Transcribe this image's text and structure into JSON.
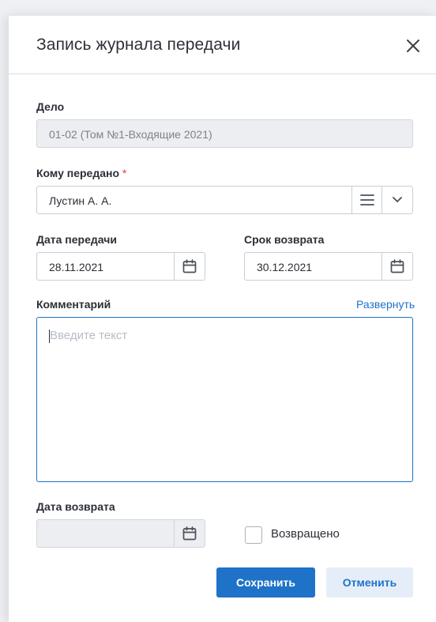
{
  "dialog": {
    "title": "Запись журнала передачи",
    "close_icon": "close-icon"
  },
  "case_field": {
    "label": "Дело",
    "value": "01-02 (Том №1-Входящие 2021)"
  },
  "recipient_field": {
    "label": "Кому передано",
    "required_mark": "*",
    "value": "Лустин А. А.",
    "icons": [
      "list-icon",
      "chevron-down-icon"
    ]
  },
  "transfer_date": {
    "label": "Дата передачи",
    "value": "28.11.2021",
    "icon": "calendar-icon"
  },
  "return_deadline": {
    "label": "Срок возврата",
    "value": "30.12.2021",
    "icon": "calendar-icon"
  },
  "comment": {
    "label": "Комментарий",
    "expand_link": "Развернуть",
    "placeholder": "Введите текст",
    "value": ""
  },
  "return_date": {
    "label": "Дата возврата",
    "value": "",
    "icon": "calendar-icon"
  },
  "returned_checkbox": {
    "label": "Возвращено",
    "checked": false
  },
  "actions": {
    "save_label": "Сохранить",
    "cancel_label": "Отменить"
  },
  "colors": {
    "accent": "#1e73c8",
    "required": "#e53935",
    "disabled_bg": "#eceef1",
    "secondary_button_bg": "#e5eef8"
  }
}
